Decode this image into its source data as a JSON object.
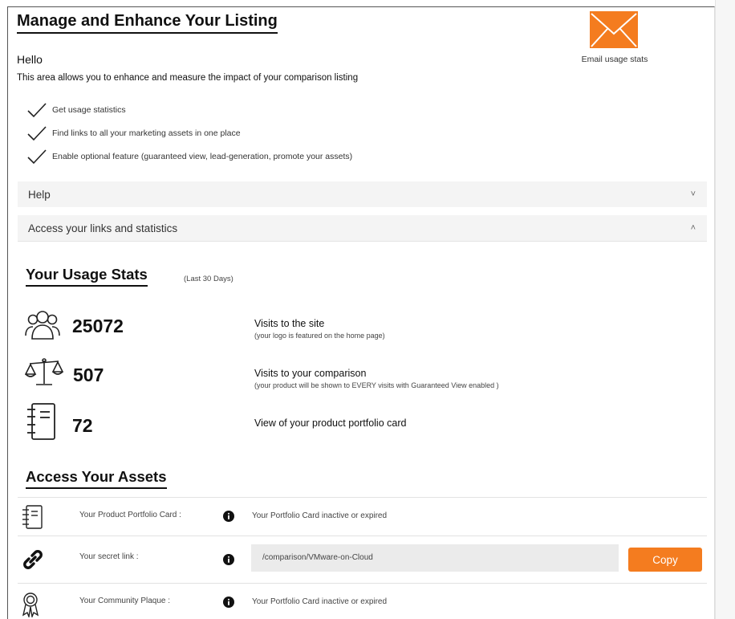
{
  "header": {
    "title": "Manage and Enhance Your Listing",
    "greeting": "Hello",
    "intro": "This area allows you to enhance and measure the impact of your comparison listing"
  },
  "email": {
    "label": "Email usage stats",
    "icon": "envelope-icon",
    "color": "#f47c1f"
  },
  "checklist": [
    "Get usage statistics",
    "Find links to all your marketing assets in one place",
    "Enable optional feature (guaranteed view, lead-generation, promote your assets)"
  ],
  "accordions": {
    "help": {
      "label": "Help",
      "chevron": "˅"
    },
    "links": {
      "label": "Access your links and statistics",
      "chevron": "˄"
    }
  },
  "usage": {
    "title": "Your Usage Stats",
    "subtitle": "(Last 30 Days)",
    "stats": [
      {
        "value": "25072",
        "label": "Visits to the site",
        "note": "(your logo is featured on the home page)",
        "icon": "users-icon"
      },
      {
        "value": "507",
        "label": "Visits to your comparison",
        "note": "(your product will be shown to EVERY visits with Guaranteed View enabled )",
        "icon": "scales-icon"
      },
      {
        "value": "72",
        "label": "View of your product portfolio card",
        "note": "",
        "icon": "notebook-icon"
      }
    ]
  },
  "assets": {
    "title": "Access Your Assets",
    "rows": [
      {
        "label": "Your Product Portfolio Card :",
        "value": "Your Portfolio Card inactive or expired",
        "icon": "notebook-icon"
      },
      {
        "label": "Your secret link :",
        "value": "/comparison/VMware-on-Cloud",
        "icon": "link-icon",
        "button": "Copy"
      },
      {
        "label": "Your Community Plaque :",
        "value": "Your Portfolio Card inactive or expired",
        "icon": "award-icon"
      }
    ]
  },
  "colors": {
    "accent": "#f47c1f",
    "accordion_bg": "#f4f4f4",
    "field_bg": "#ebebeb"
  }
}
